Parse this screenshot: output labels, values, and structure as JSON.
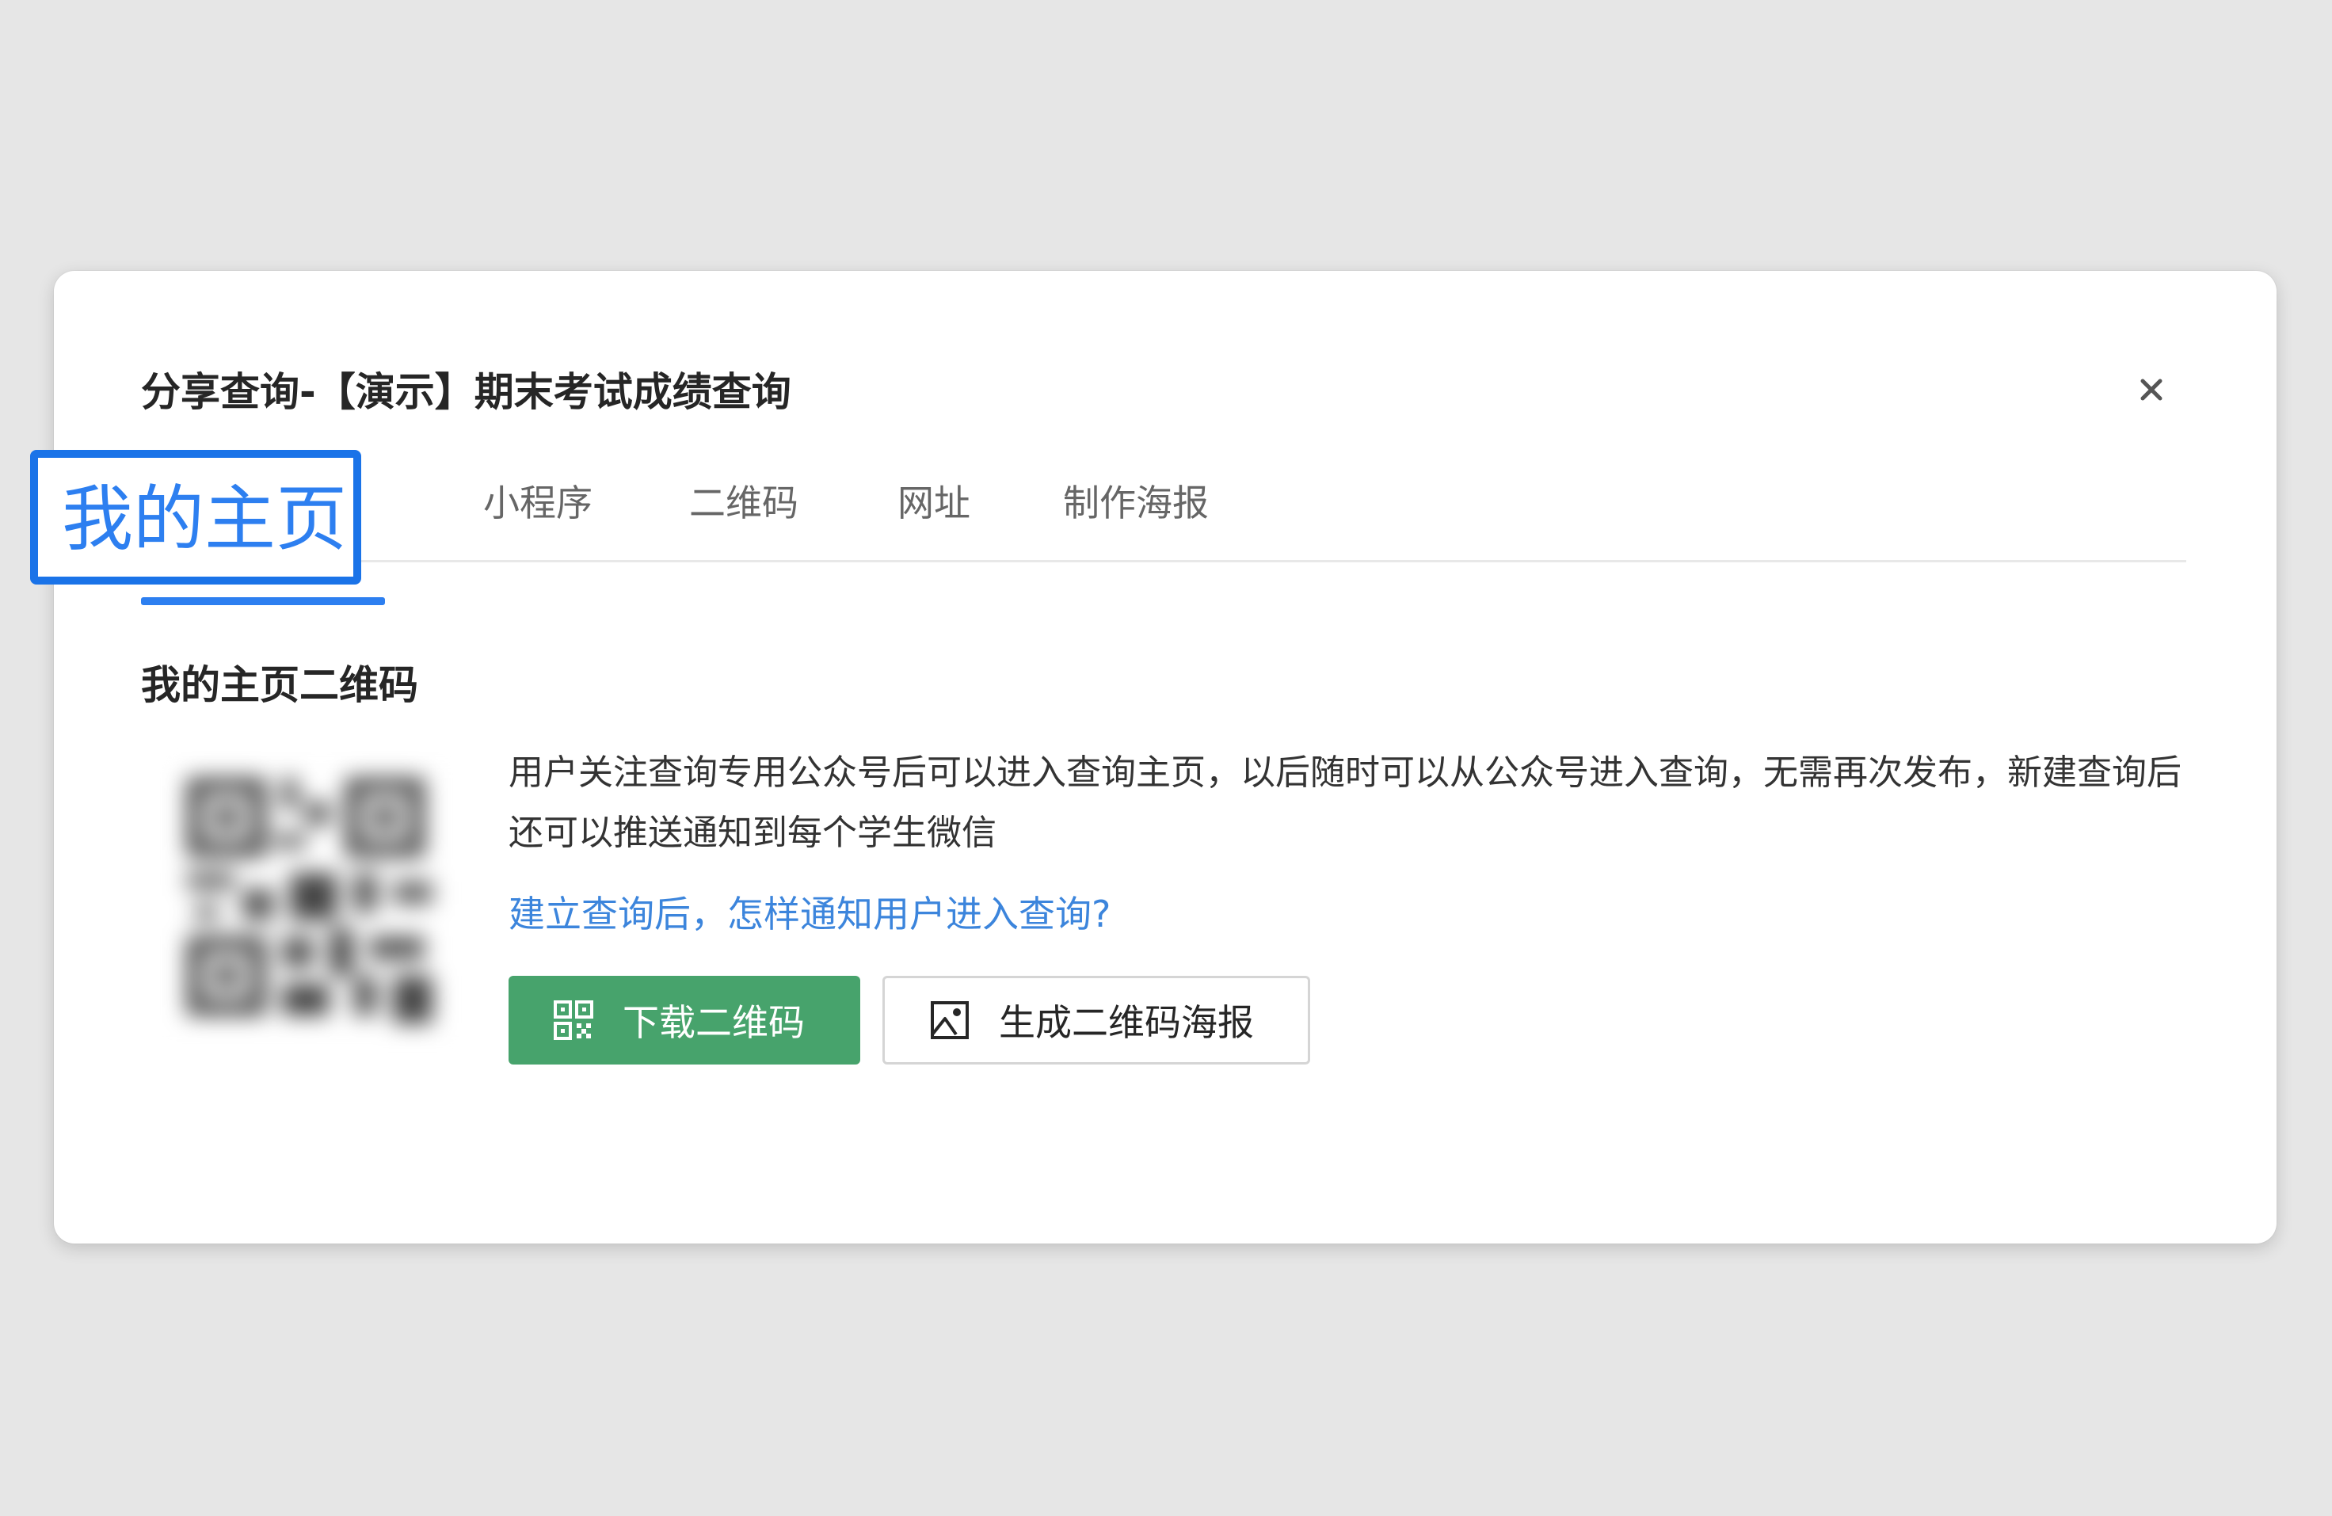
{
  "dialog": {
    "title": "分享查询-【演示】期末考试成绩查询",
    "close_icon": "close-icon"
  },
  "tabs": [
    {
      "label": "我的主页",
      "active": true
    },
    {
      "label": "小程序",
      "active": false
    },
    {
      "label": "二维码",
      "active": false
    },
    {
      "label": "网址",
      "active": false
    },
    {
      "label": "制作海报",
      "active": false
    }
  ],
  "section": {
    "title": "我的主页二维码",
    "description": "用户关注查询专用公众号后可以进入查询主页，以后随时可以从公众号进入查询，无需再次发布，新建查询后还可以推送通知到每个学生微信",
    "help_link": "建立查询后，怎样通知用户进入查询?"
  },
  "buttons": {
    "download_qr": {
      "label": "下载二维码",
      "icon": "qr-code-icon"
    },
    "generate_poster": {
      "label": "生成二维码海报",
      "icon": "image-icon"
    }
  },
  "colors": {
    "accent": "#2d7ff0",
    "highlight_border": "#1a73e8",
    "link": "#3c85dc",
    "primary_button": "#47a36c",
    "background": "#e6e6e6"
  }
}
